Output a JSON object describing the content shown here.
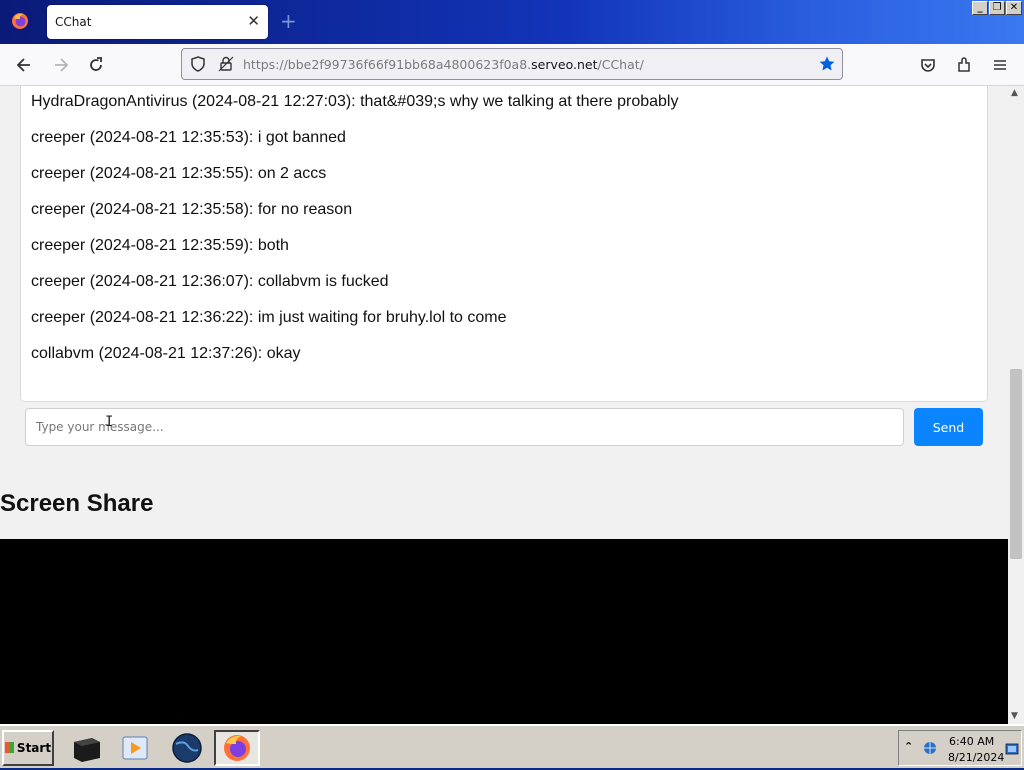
{
  "browser": {
    "tab_title": "CChat",
    "tab_close": "✕",
    "new_tab": "+",
    "url_prefix": "https://bbe2f99736f66f91bb68a4800623f0a8.",
    "url_host": "serveo.net",
    "url_path": "/CChat/",
    "window_controls": [
      "_",
      "❐",
      "✕"
    ]
  },
  "chat": {
    "messages": [
      "HydraDragonAntivirus (2024-08-21 12:27:03): that&#039;s why we talking at there probably",
      "creeper (2024-08-21 12:35:53): i got banned",
      "creeper (2024-08-21 12:35:55): on 2 accs",
      "creeper (2024-08-21 12:35:58): for no reason",
      "creeper (2024-08-21 12:35:59): both",
      "creeper (2024-08-21 12:36:07): collabvm is fucked",
      "creeper (2024-08-21 12:36:22): im just waiting for bruhy.lol to come",
      "collabvm (2024-08-21 12:37:26): okay"
    ],
    "input_placeholder": "Type your message...",
    "input_value": "",
    "send_label": "Send"
  },
  "screen_share": {
    "title": "Screen Share"
  },
  "taskbar": {
    "start_label": "Start",
    "clock_time": "6:40 AM",
    "clock_date": "8/21/2024",
    "tray_expand": "⌃"
  },
  "colors": {
    "send_button": "#0a84ff",
    "bookmark_star": "#0060df",
    "titlebar_gradient_start": "#0a1a78",
    "titlebar_gradient_end": "#3a78f0"
  },
  "icons": [
    "firefox-icon",
    "back-icon",
    "forward-icon",
    "reload-icon",
    "shield-icon",
    "lock-icon",
    "bookmark-star-icon",
    "pocket-icon",
    "extensions-icon",
    "menu-icon",
    "terminal-icon",
    "media-player-icon",
    "globe-icon",
    "firefox-taskbar-icon",
    "network-icon",
    "volume-icon"
  ]
}
